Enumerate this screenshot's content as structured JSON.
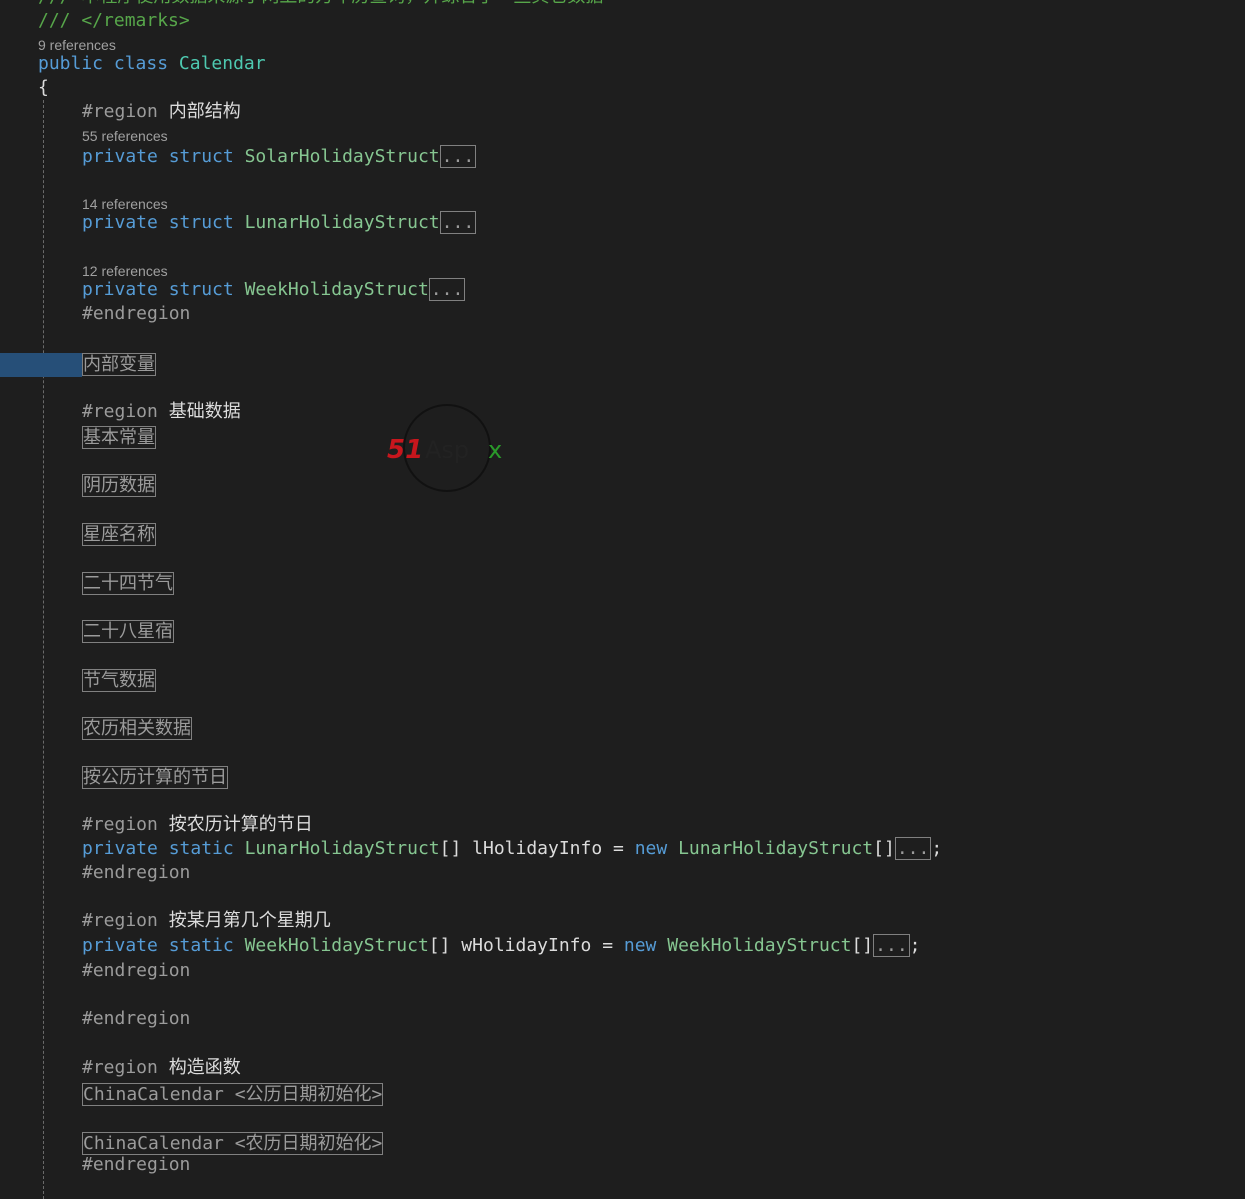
{
  "colors": {
    "background": "#1e1e1e",
    "keyword": "#569cd6",
    "type": "#4ec9b0",
    "struct": "#86c691",
    "comment": "#57a64a",
    "preprocessor": "#9b9b9b",
    "selection": "#264f78"
  },
  "watermark": {
    "text": "51Aspx"
  },
  "lines": [
    {
      "indent": 0,
      "tokens": [
        {
          "c": "cm",
          "t": "/// 本程序使用数据来源于网上的万年历查询，并综合了一些其它数据"
        }
      ]
    },
    {
      "indent": 0,
      "tokens": [
        {
          "c": "cm",
          "t": "/// </remarks>"
        }
      ]
    },
    {
      "indent": 0,
      "refs": "9 references"
    },
    {
      "indent": 0,
      "tokens": [
        {
          "c": "kw",
          "t": "public class "
        },
        {
          "c": "ty",
          "t": "Calendar"
        }
      ]
    },
    {
      "indent": 0,
      "tokens": [
        {
          "c": "",
          "t": "{"
        }
      ]
    },
    {
      "indent": 1,
      "tokens": [
        {
          "c": "pp",
          "t": "#region "
        },
        {
          "c": "cn",
          "t": "内部结构"
        }
      ]
    },
    {
      "indent": 1,
      "refs": "55 references"
    },
    {
      "indent": 1,
      "tokens": [
        {
          "c": "kw",
          "t": "private struct "
        },
        {
          "c": "st",
          "t": "SolarHolidayStruct"
        },
        {
          "c": "box",
          "t": "..."
        }
      ]
    },
    {
      "indent": 1,
      "refs": "14 references"
    },
    {
      "indent": 1,
      "tokens": [
        {
          "c": "kw",
          "t": "private struct "
        },
        {
          "c": "st",
          "t": "LunarHolidayStruct"
        },
        {
          "c": "box",
          "t": "..."
        }
      ]
    },
    {
      "indent": 1,
      "refs": "12 references"
    },
    {
      "indent": 1,
      "tokens": [
        {
          "c": "kw",
          "t": "private struct "
        },
        {
          "c": "st",
          "t": "WeekHolidayStruct"
        },
        {
          "c": "box",
          "t": "..."
        }
      ]
    },
    {
      "indent": 1,
      "tokens": [
        {
          "c": "pp",
          "t": "#endregion"
        }
      ]
    },
    {
      "indent": 1,
      "tokens": [
        {
          "c": "cbox",
          "t": "内部变量"
        }
      ]
    },
    {
      "indent": 1,
      "tokens": [
        {
          "c": "pp",
          "t": "#region "
        },
        {
          "c": "cn",
          "t": "基础数据"
        }
      ]
    },
    {
      "indent": 1,
      "tokens": [
        {
          "c": "cbox",
          "t": "基本常量"
        }
      ]
    },
    {
      "indent": 1,
      "tokens": [
        {
          "c": "cbox",
          "t": "阴历数据"
        }
      ]
    },
    {
      "indent": 1,
      "tokens": [
        {
          "c": "cbox",
          "t": "星座名称"
        }
      ]
    },
    {
      "indent": 1,
      "tokens": [
        {
          "c": "cbox",
          "t": "二十四节气"
        }
      ]
    },
    {
      "indent": 1,
      "tokens": [
        {
          "c": "cbox",
          "t": "二十八星宿"
        }
      ]
    },
    {
      "indent": 1,
      "tokens": [
        {
          "c": "cbox",
          "t": "节气数据"
        }
      ]
    },
    {
      "indent": 1,
      "tokens": [
        {
          "c": "cbox",
          "t": "农历相关数据"
        }
      ]
    },
    {
      "indent": 1,
      "tokens": [
        {
          "c": "cbox",
          "t": "按公历计算的节日"
        }
      ]
    },
    {
      "indent": 1,
      "tokens": [
        {
          "c": "pp",
          "t": "#region "
        },
        {
          "c": "cn",
          "t": "按农历计算的节日"
        }
      ]
    },
    {
      "indent": 1,
      "tokens": [
        {
          "c": "kw",
          "t": "private static "
        },
        {
          "c": "st",
          "t": "LunarHolidayStruct"
        },
        {
          "c": "",
          "t": "[] lHolidayInfo = "
        },
        {
          "c": "kw",
          "t": "new "
        },
        {
          "c": "st",
          "t": "LunarHolidayStruct"
        },
        {
          "c": "",
          "t": "[]"
        },
        {
          "c": "box",
          "t": "..."
        },
        {
          "c": "",
          "t": ";"
        }
      ]
    },
    {
      "indent": 1,
      "tokens": [
        {
          "c": "pp",
          "t": "#endregion"
        }
      ]
    },
    {
      "indent": 1,
      "tokens": [
        {
          "c": "pp",
          "t": "#region "
        },
        {
          "c": "cn",
          "t": "按某月第几个星期几"
        }
      ]
    },
    {
      "indent": 1,
      "tokens": [
        {
          "c": "kw",
          "t": "private static "
        },
        {
          "c": "st",
          "t": "WeekHolidayStruct"
        },
        {
          "c": "",
          "t": "[] wHolidayInfo = "
        },
        {
          "c": "kw",
          "t": "new "
        },
        {
          "c": "st",
          "t": "WeekHolidayStruct"
        },
        {
          "c": "",
          "t": "[]"
        },
        {
          "c": "box",
          "t": "..."
        },
        {
          "c": "",
          "t": ";"
        }
      ]
    },
    {
      "indent": 1,
      "tokens": [
        {
          "c": "pp",
          "t": "#endregion"
        }
      ]
    },
    {
      "indent": 1,
      "tokens": [
        {
          "c": "pp",
          "t": "#endregion"
        }
      ]
    },
    {
      "indent": 1,
      "tokens": [
        {
          "c": "pp",
          "t": "#region "
        },
        {
          "c": "cn",
          "t": "构造函数"
        }
      ]
    },
    {
      "indent": 1,
      "tokens": [
        {
          "c": "cbox",
          "t": "ChinaCalendar <公历日期初始化>"
        }
      ]
    },
    {
      "indent": 1,
      "tokens": [
        {
          "c": "cbox",
          "t": "ChinaCalendar <农历日期初始化>"
        }
      ]
    },
    {
      "indent": 1,
      "tokens": [
        {
          "c": "pp",
          "t": "#endregion"
        }
      ]
    }
  ]
}
